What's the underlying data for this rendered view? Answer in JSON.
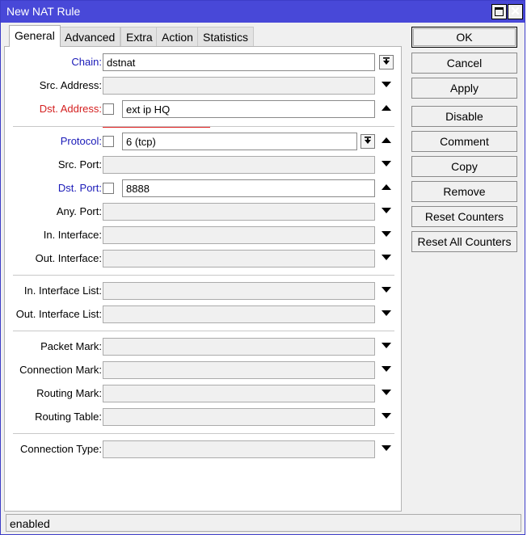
{
  "window": {
    "title": "New NAT Rule",
    "maximize_icon": "maximize-icon",
    "close_icon": "close-icon",
    "close_glyph": "✕"
  },
  "tabs": [
    {
      "label": "General",
      "active": true
    },
    {
      "label": "Advanced",
      "active": false
    },
    {
      "label": "Extra",
      "active": false
    },
    {
      "label": "Action",
      "active": false
    },
    {
      "label": "Statistics",
      "active": false
    }
  ],
  "form": {
    "chain": {
      "label": "Chain:",
      "value": "dstnat"
    },
    "src_address": {
      "label": "Src. Address:",
      "value": ""
    },
    "dst_address": {
      "label": "Dst. Address:",
      "value": "ext ip HQ"
    },
    "protocol": {
      "label": "Protocol:",
      "value": "6 (tcp)"
    },
    "src_port": {
      "label": "Src. Port:",
      "value": ""
    },
    "dst_port": {
      "label": "Dst. Port:",
      "value": "8888"
    },
    "any_port": {
      "label": "Any. Port:",
      "value": ""
    },
    "in_interface": {
      "label": "In. Interface:",
      "value": ""
    },
    "out_interface": {
      "label": "Out. Interface:",
      "value": ""
    },
    "in_interface_list": {
      "label": "In. Interface List:",
      "value": ""
    },
    "out_interface_list": {
      "label": "Out. Interface List:",
      "value": ""
    },
    "packet_mark": {
      "label": "Packet Mark:",
      "value": ""
    },
    "connection_mark": {
      "label": "Connection Mark:",
      "value": ""
    },
    "routing_mark": {
      "label": "Routing Mark:",
      "value": ""
    },
    "routing_table": {
      "label": "Routing Table:",
      "value": ""
    },
    "connection_type": {
      "label": "Connection Type:",
      "value": ""
    }
  },
  "buttons": {
    "ok": "OK",
    "cancel": "Cancel",
    "apply": "Apply",
    "disable": "Disable",
    "comment": "Comment",
    "copy": "Copy",
    "remove": "Remove",
    "reset_counters": "Reset Counters",
    "reset_all_counters": "Reset All Counters"
  },
  "status": {
    "text": "enabled"
  },
  "colors": {
    "titlebar": "#4848d8",
    "label_blue": "#1a1ab8",
    "label_red": "#d42020",
    "underline_red": "#e02020"
  }
}
